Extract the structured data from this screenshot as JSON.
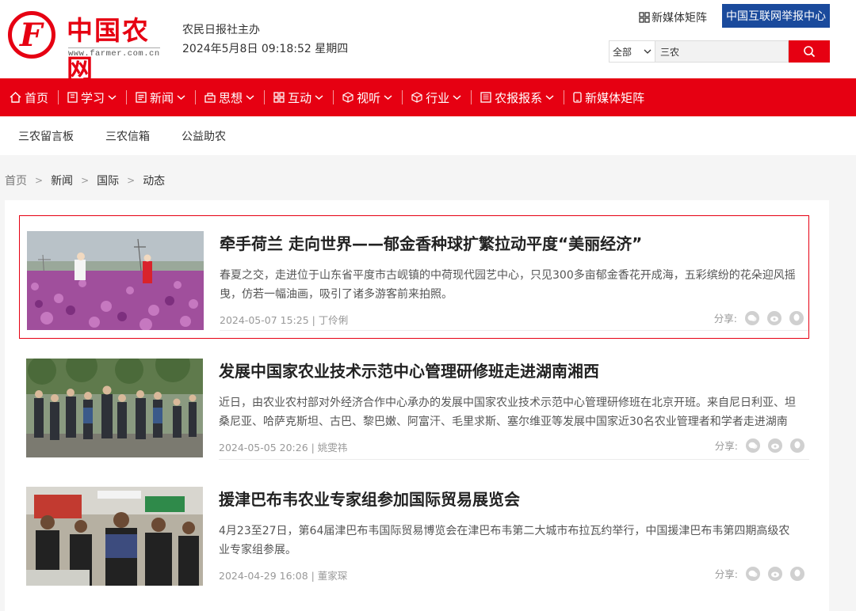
{
  "header": {
    "logo_name": "中国农网",
    "logo_url": "www.farmer.com.cn",
    "org": "农民日报社主办",
    "datetime": "2024年5月8日 09:18:52 星期四",
    "media_link": "新媒体矩阵",
    "report_button": "中国互联网举报中心",
    "search": {
      "scope": "全部",
      "value": "三农"
    }
  },
  "nav": [
    {
      "label": "首页",
      "icon": "home-icon",
      "dropdown": false
    },
    {
      "label": "学习",
      "icon": "book-icon",
      "dropdown": true
    },
    {
      "label": "新闻",
      "icon": "news-icon",
      "dropdown": true
    },
    {
      "label": "思想",
      "icon": "thought-icon",
      "dropdown": true
    },
    {
      "label": "互动",
      "icon": "grid-icon",
      "dropdown": true
    },
    {
      "label": "视听",
      "icon": "cube-icon",
      "dropdown": true
    },
    {
      "label": "行业",
      "icon": "box-icon",
      "dropdown": true
    },
    {
      "label": "农报报系",
      "icon": "paper-icon",
      "dropdown": true
    },
    {
      "label": "新媒体矩阵",
      "icon": "phone-icon",
      "dropdown": false
    }
  ],
  "subnav": [
    "三农留言板",
    "三农信箱",
    "公益助农"
  ],
  "breadcrumb": [
    "首页",
    "新闻",
    "国际",
    "动态"
  ],
  "articles": [
    {
      "title": "牵手荷兰 走向世界——郁金香种球扩繁拉动平度“美丽经济”",
      "desc": "春夏之交，走进位于山东省平度市古岘镇的中荷现代园艺中心，只见300多亩郁金香花开成海，五彩缤纷的花朵迎风摇曳，仿若一幅油画，吸引了诸多游客前来拍照。",
      "meta": "2024-05-07 15:25 | 丁伶俐",
      "share": "分享:"
    },
    {
      "title": "发展中国家农业技术示范中心管理研修班走进湖南湘西",
      "desc": "近日，由农业农村部对外经济合作中心承办的发展中国家农业技术示范中心管理研修班在北京开班。来自尼日利亚、坦桑尼亚、哈萨克斯坦、古巴、黎巴嫩、阿富汗、毛里求斯、塞尔维亚等发展中国家近30名农业管理者和学者走进湖南省湘...",
      "meta": "2024-05-05 20:26 | 姚雯祎",
      "share": "分享:"
    },
    {
      "title": "援津巴布韦农业专家组参加国际贸易展览会",
      "desc": "4月23至27日，第64届津巴布韦国际贸易博览会在津巴布韦第二大城市布拉瓦约举行，中国援津巴布韦第四期高级农业专家组参展。",
      "meta": "2024-04-29 16:08 | 董家琛",
      "share": "分享:"
    }
  ],
  "colors": {
    "brand_red": "#e60012",
    "report_blue": "#1a4a9c"
  }
}
